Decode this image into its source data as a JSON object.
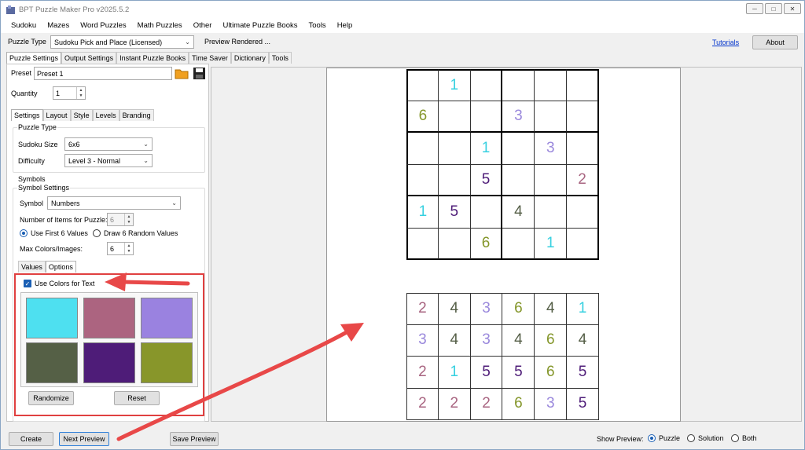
{
  "window": {
    "title": "BPT Puzzle Maker Pro v2025.5.2"
  },
  "menu": [
    "Sudoku",
    "Mazes",
    "Word Puzzles",
    "Math Puzzles",
    "Other",
    "Ultimate Puzzle Books",
    "Tools",
    "Help"
  ],
  "typebar": {
    "label": "Puzzle Type",
    "value": "Sudoku Pick and Place (Licensed)",
    "status": "Preview Rendered ...",
    "tutorials": "Tutorials",
    "about": "About"
  },
  "main_tabs": [
    "Puzzle Settings",
    "Output Settings",
    "Instant Puzzle Books",
    "Time Saver",
    "Dictionary",
    "Tools"
  ],
  "preset": {
    "label": "Preset",
    "value": "Preset 1"
  },
  "quantity": {
    "label": "Quantity",
    "value": "1"
  },
  "sub_tabs": [
    "Settings",
    "Layout",
    "Style",
    "Levels",
    "Branding"
  ],
  "puzzle_type_group": {
    "title": "Puzzle Type",
    "size_label": "Sudoku Size",
    "size_value": "6x6",
    "difficulty_label": "Difficulty",
    "difficulty_value": "Level 3 - Normal"
  },
  "symbols": {
    "title": "Symbols",
    "settings_title": "Symbol Settings",
    "symbol_label": "Symbol",
    "symbol_value": "Numbers",
    "items_label": "Number of Items for Puzzle:",
    "items_value": "6",
    "radio_first": "Use First 6 Values",
    "radio_random": "Draw 6 Random Values",
    "max_label": "Max Colors/Images:",
    "max_value": "6"
  },
  "option_tabs": [
    "Values",
    "Options"
  ],
  "colors": {
    "checkbox_label": "Use Colors for Text",
    "swatches": [
      "#4ee0f0",
      "#ac6480",
      "#9a82e0",
      "#556046",
      "#4e1c78",
      "#88962a"
    ],
    "randomize": "Randomize",
    "reset": "Reset"
  },
  "palette": {
    "1": "#36d0e0",
    "2": "#a86480",
    "3": "#9a88dc",
    "4": "#545e46",
    "5": "#4e1c78",
    "6": "#84962a"
  },
  "puzzle_grid": [
    [
      "",
      "1",
      "",
      "",
      "",
      ""
    ],
    [
      "6",
      "",
      "",
      "3",
      "",
      ""
    ],
    [
      "",
      "",
      "1",
      "",
      "3",
      ""
    ],
    [
      "",
      "",
      "5",
      "",
      "",
      "2"
    ],
    [
      "1",
      "5",
      "",
      "4",
      "",
      ""
    ],
    [
      "",
      "",
      "6",
      "",
      "1",
      ""
    ]
  ],
  "pieces_grid": [
    [
      "2",
      "4",
      "3",
      "6",
      "4",
      "1"
    ],
    [
      "3",
      "4",
      "3",
      "4",
      "6",
      "4"
    ],
    [
      "2",
      "1",
      "5",
      "5",
      "6",
      "5"
    ],
    [
      "2",
      "2",
      "2",
      "6",
      "3",
      "5"
    ]
  ],
  "bottom": {
    "create": "Create",
    "next_preview": "Next Preview",
    "save_preview": "Save Preview",
    "show_preview_label": "Show Preview:",
    "opt_puzzle": "Puzzle",
    "opt_solution": "Solution",
    "opt_both": "Both"
  }
}
